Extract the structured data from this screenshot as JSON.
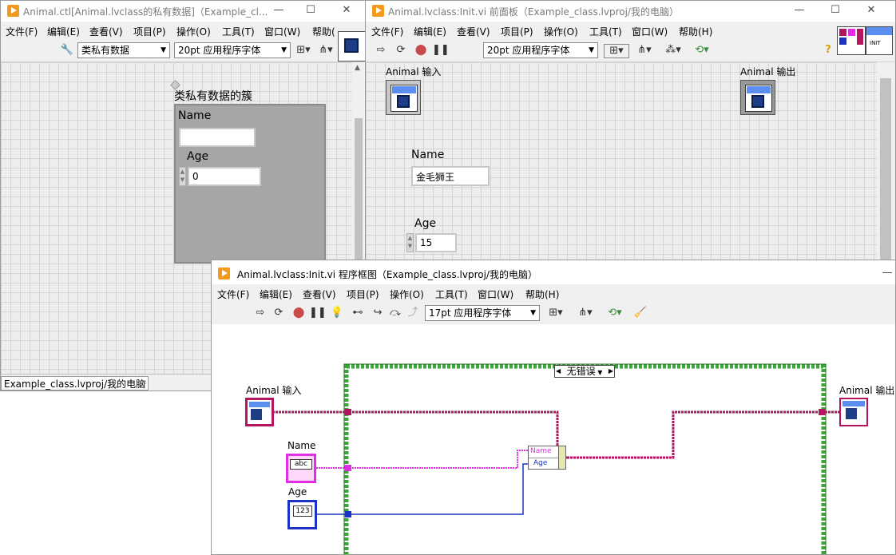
{
  "ctl_window": {
    "title": "Animal.ctl[Animal.lvclass的私有数据]（Example_cl...",
    "menus": [
      "文件(F)",
      "编辑(E)",
      "查看(V)",
      "项目(P)",
      "操作(O)",
      "工具(T)",
      "窗口(W)",
      "帮助("
    ],
    "type_dropdown": "类私有数据",
    "font_dropdown": "20pt 应用程序字体",
    "cluster_label": "类私有数据的簇",
    "name_label": "Name",
    "name_value": "",
    "age_label": "Age",
    "age_value": "0",
    "status_path": "Example_class.lvproj/我的电脑"
  },
  "fp_window": {
    "title": "Animal.lvclass:Init.vi 前面板（Example_class.lvproj/我的电脑）",
    "menus": [
      "文件(F)",
      "编辑(E)",
      "查看(V)",
      "项目(P)",
      "操作(O)",
      "工具(T)",
      "窗口(W)",
      "帮助(H)"
    ],
    "font_dropdown": "20pt 应用程序字体",
    "animal_in_label": "Animal 输入",
    "animal_out_label": "Animal 输出",
    "name_label": "Name",
    "name_value": "金毛狮王",
    "age_label": "Age",
    "age_value": "15",
    "conn_pane_text": "INIT"
  },
  "bd_window": {
    "title": "Animal.lvclass:Init.vi 程序框图（Example_class.lvproj/我的电脑）",
    "menus": [
      "文件(F)",
      "编辑(E)",
      "查看(V)",
      "项目(P)",
      "操作(O)",
      "工具(T)",
      "窗口(W)",
      "帮助(H)"
    ],
    "font_dropdown": "17pt 应用程序字体",
    "case_selector": "无错误",
    "animal_in_label": "Animal 输入",
    "animal_out_label": "Animal 输出",
    "name_label": "Name",
    "age_label": "Age",
    "name_term_text": "abc",
    "age_term_text": "123",
    "unbundle_items": [
      "Name",
      "Age"
    ]
  },
  "colors": {
    "class_wire": "#b3165e",
    "string_wire": "#e12de3",
    "numeric_wire": "#1c32c4",
    "case_border": "#3aa63a",
    "labview_orange": "#f29a1b"
  }
}
